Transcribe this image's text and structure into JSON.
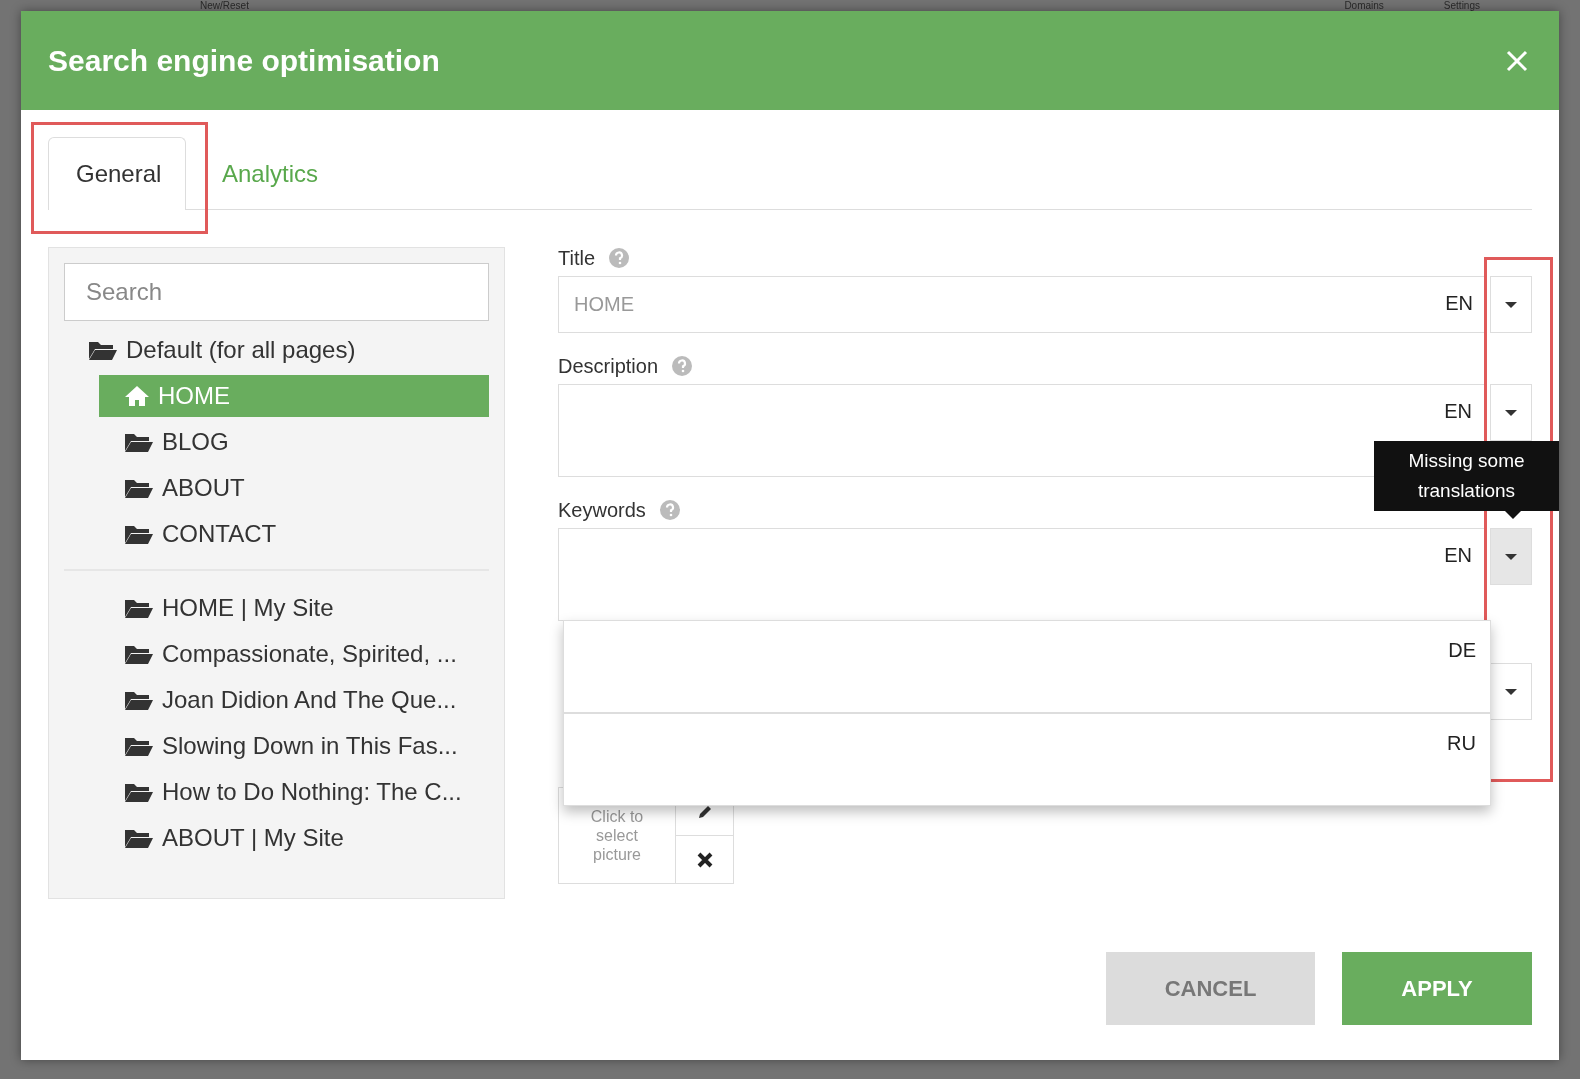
{
  "backdrop": {
    "toolbar": [
      "New/Reset",
      "Domains",
      "Settings"
    ]
  },
  "dialog": {
    "title": "Search engine optimisation"
  },
  "tabs": [
    {
      "label": "General",
      "selected": true
    },
    {
      "label": "Analytics",
      "selected": false
    }
  ],
  "pages_panel": {
    "search": {
      "placeholder": "Search"
    },
    "tree": [
      {
        "label": "Default (for all pages)",
        "kind": "folder",
        "selected": false,
        "children": [
          {
            "label": "HOME",
            "kind": "home",
            "selected": true
          },
          {
            "label": "BLOG",
            "kind": "folder",
            "selected": false
          },
          {
            "label": "ABOUT",
            "kind": "folder",
            "selected": false
          },
          {
            "label": "CONTACT",
            "kind": "folder",
            "selected": false
          }
        ]
      }
    ],
    "list": [
      {
        "label": "HOME | My Site",
        "selected": false
      },
      {
        "label": "Compassionate, Spirited, ...",
        "selected": false
      },
      {
        "label": "Joan Didion And The Que...",
        "selected": false
      },
      {
        "label": "Slowing Down in This Fas...",
        "selected": false
      },
      {
        "label": "How to Do Nothing: The C...",
        "selected": false
      },
      {
        "label": "ABOUT | My Site",
        "selected": false
      }
    ]
  },
  "fields": [
    {
      "label": "Title",
      "kind": "input",
      "placeholder": "HOME",
      "lang": "EN",
      "menu_open": false
    },
    {
      "label": "Description",
      "kind": "textarea",
      "lang": "EN",
      "menu_open": false
    },
    {
      "label": "Keywords",
      "kind": "textarea",
      "lang": "EN",
      "menu_open": true
    }
  ],
  "tooltip": "Missing some translations",
  "language_popup": [
    {
      "lang": "DE"
    },
    {
      "lang": "RU"
    }
  ],
  "picture": {
    "text": "Click to select picture"
  },
  "buttons": [
    {
      "label": "CANCEL",
      "kind": "secondary"
    },
    {
      "label": "APPLY",
      "kind": "primary"
    }
  ]
}
